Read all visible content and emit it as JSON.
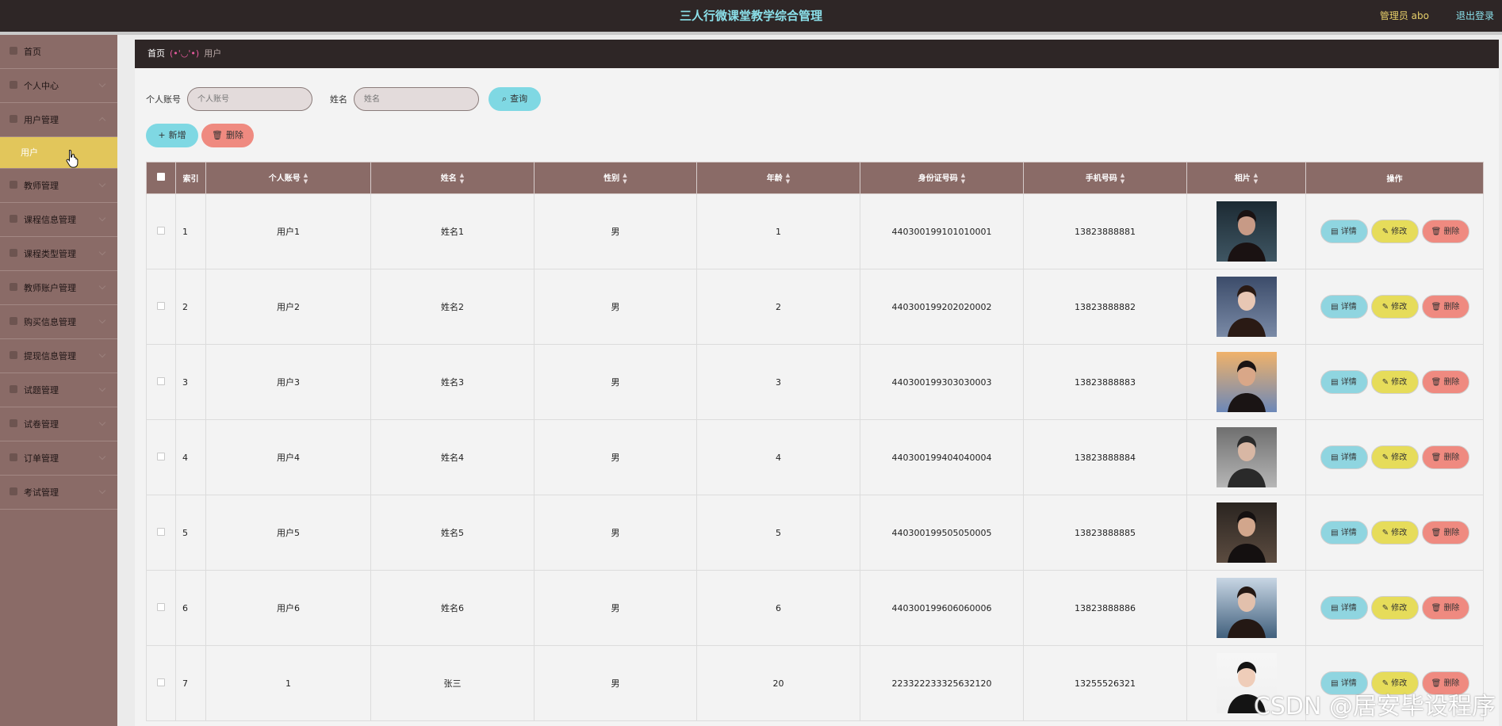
{
  "header": {
    "title": "三人行微课堂教学综合管理",
    "admin": "管理员 abo",
    "logout": "退出登录"
  },
  "sidebar": {
    "items": [
      {
        "label": "首页"
      },
      {
        "label": "个人中心"
      },
      {
        "label": "用户管理"
      },
      {
        "label": "用户",
        "active": true
      },
      {
        "label": "教师管理"
      },
      {
        "label": "课程信息管理"
      },
      {
        "label": "课程类型管理"
      },
      {
        "label": "教师账户管理"
      },
      {
        "label": "购买信息管理"
      },
      {
        "label": "提现信息管理"
      },
      {
        "label": "试题管理"
      },
      {
        "label": "试卷管理"
      },
      {
        "label": "订单管理"
      },
      {
        "label": "考试管理"
      }
    ]
  },
  "breadcrumb": {
    "home": "首页",
    "face": "(•'◡'•)",
    "current": "用户"
  },
  "search": {
    "account_label": "个人账号",
    "account_placeholder": "个人账号",
    "name_label": "姓名",
    "name_placeholder": "姓名",
    "query_label": "查询"
  },
  "actions": {
    "add_label": "新增",
    "delete_label": "删除"
  },
  "table": {
    "headers": [
      "索引",
      "个人账号",
      "姓名",
      "性别",
      "年龄",
      "身份证号码",
      "手机号码",
      "相片",
      "操作"
    ],
    "rows": [
      {
        "index": "1",
        "account": "用户1",
        "name": "姓名1",
        "gender": "男",
        "age": "1",
        "idcard": "440300199101010001",
        "phone": "13823888881",
        "photo": "portrait-man-dark"
      },
      {
        "index": "2",
        "account": "用户2",
        "name": "姓名2",
        "gender": "男",
        "age": "2",
        "idcard": "440300199202020002",
        "phone": "13823888882",
        "photo": "portrait-woman-coat"
      },
      {
        "index": "3",
        "account": "用户3",
        "name": "姓名3",
        "gender": "男",
        "age": "3",
        "idcard": "440300199303030003",
        "phone": "13823888883",
        "photo": "portrait-sunset"
      },
      {
        "index": "4",
        "account": "用户4",
        "name": "姓名4",
        "gender": "男",
        "age": "4",
        "idcard": "440300199404040004",
        "phone": "13823888884",
        "photo": "portrait-street"
      },
      {
        "index": "5",
        "account": "用户5",
        "name": "姓名5",
        "gender": "男",
        "age": "5",
        "idcard": "440300199505050005",
        "phone": "13823888885",
        "photo": "portrait-cafe"
      },
      {
        "index": "6",
        "account": "用户6",
        "name": "姓名6",
        "gender": "男",
        "age": "6",
        "idcard": "440300199606060006",
        "phone": "13823888886",
        "photo": "portrait-sea"
      },
      {
        "index": "7",
        "account": "1",
        "name": "张三",
        "gender": "男",
        "age": "20",
        "idcard": "223322233325632120",
        "phone": "13255526321",
        "photo": "portrait-white-bg"
      }
    ],
    "op_labels": {
      "detail": "详情",
      "edit": "修改",
      "delete": "删除"
    }
  },
  "watermark": "CSDN @居安毕设程序",
  "colors": {
    "header_bg": "#2e2626",
    "sidebar_bg": "#8a6b67",
    "active_item": "#e2c65b",
    "accent_cyan": "#7fd8e3",
    "accent_yellow": "#e6dc5a",
    "accent_red": "#ef8a80"
  }
}
